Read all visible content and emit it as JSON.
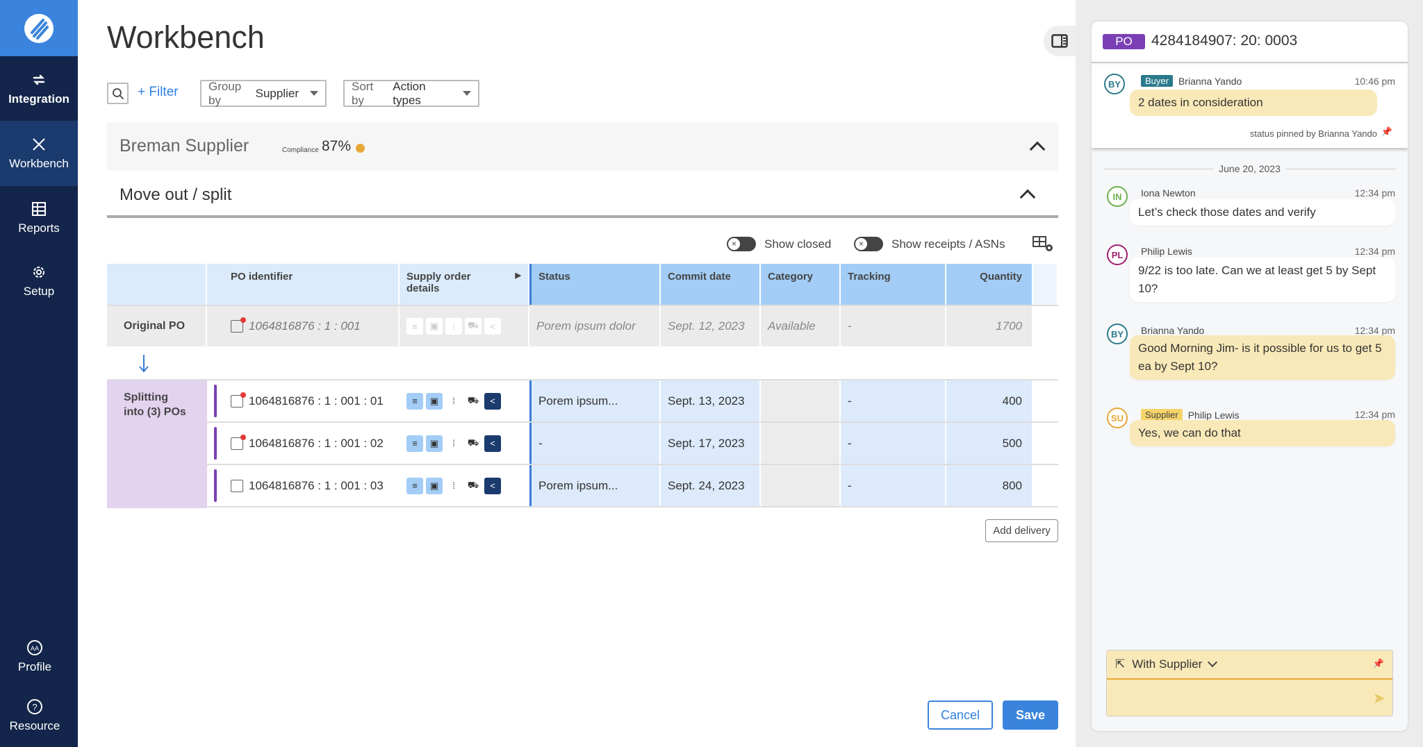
{
  "sidebar": {
    "items": [
      {
        "label": "Integration",
        "icon": "sync-icon"
      },
      {
        "label": "Workbench",
        "icon": "tools-icon",
        "active": true
      },
      {
        "label": "Reports",
        "icon": "table-icon"
      },
      {
        "label": "Setup",
        "icon": "gear-icon"
      },
      {
        "label": "Profile",
        "icon": "profile-icon"
      },
      {
        "label": "Resource",
        "icon": "help-icon"
      }
    ]
  },
  "page": {
    "title": "Workbench"
  },
  "toolbar": {
    "filter": "+ Filter",
    "group_by_label": "Group by",
    "group_by_value": "Supplier",
    "sort_by_label": "Sort by",
    "sort_by_value": "Action types"
  },
  "supplier": {
    "name": "Breman Supplier",
    "compliance_label": "Compliance",
    "compliance_value": "87%",
    "status_color": "#e8a838"
  },
  "section": {
    "title": "Move out / split"
  },
  "toggles": {
    "show_closed": "Show closed",
    "show_receipts": "Show receipts / ASNs"
  },
  "table": {
    "headers": [
      "",
      "PO identifier",
      "Supply order details",
      "Status",
      "Commit date",
      "Category",
      "Tracking",
      "Quantity"
    ],
    "original": {
      "label": "Original PO",
      "po": "1064816876 : 1 : 001",
      "status": "Porem ipsum dolor",
      "commit": "Sept. 12, 2023",
      "category": "Available",
      "tracking": "-",
      "quantity": "1700"
    },
    "split_label": "Splitting into (3) POs",
    "splits": [
      {
        "po": "1064816876 : 1 : 001 : 01",
        "status": "Porem ipsum...",
        "commit": "Sept. 13, 2023",
        "category": "",
        "tracking": "-",
        "quantity": "400",
        "unread": true
      },
      {
        "po": "1064816876 : 1 : 001 : 02",
        "status": "-",
        "commit": "Sept. 17, 2023",
        "category": "",
        "tracking": "-",
        "quantity": "500",
        "unread": true
      },
      {
        "po": "1064816876 : 1 : 001 : 03",
        "status": "Porem ipsum...",
        "commit": "Sept. 24, 2023",
        "category": "",
        "tracking": "-",
        "quantity": "800",
        "unread": false
      }
    ]
  },
  "actions": {
    "add_delivery": "Add delivery",
    "cancel": "Cancel",
    "save": "Save"
  },
  "chat": {
    "po_badge": "PO",
    "po_number": "4284184907: 20: 0003",
    "pinned": {
      "initials": "BY",
      "role": "Buyer",
      "name": "Brianna Yando",
      "time": "10:46 pm",
      "text": "2 dates in consideration",
      "footer": "status pinned by Brianna Yando"
    },
    "date": "June 20, 2023",
    "messages": [
      {
        "initials": "IN",
        "name": "Iona Newton",
        "role": "",
        "time": "12:34 pm",
        "text": "Let’s check those dates and verify",
        "color": "#6ab04c",
        "bubble": "#ffffff"
      },
      {
        "initials": "PL",
        "name": "Philip Lewis",
        "role": "",
        "time": "12:34 pm",
        "text": "9/22 is too late. Can we at least get 5 by Sept 10?",
        "color": "#a0206e",
        "bubble": "#ffffff"
      },
      {
        "initials": "BY",
        "name": "Brianna Yando",
        "role": "",
        "time": "12:34 pm",
        "text": "Good Morning Jim- is it possible for us to get 5 ea by Sept 10?",
        "color": "#2b7a8c",
        "bubble": "#f9e9b8"
      },
      {
        "initials": "SU",
        "name": "Philip Lewis",
        "role": "Supplier",
        "time": "12:34 pm",
        "text": "Yes, we can do that",
        "color": "#e8a838",
        "bubble": "#f9e9b8"
      }
    ],
    "composer": {
      "recipient": "With Supplier",
      "placeholder": ""
    }
  }
}
